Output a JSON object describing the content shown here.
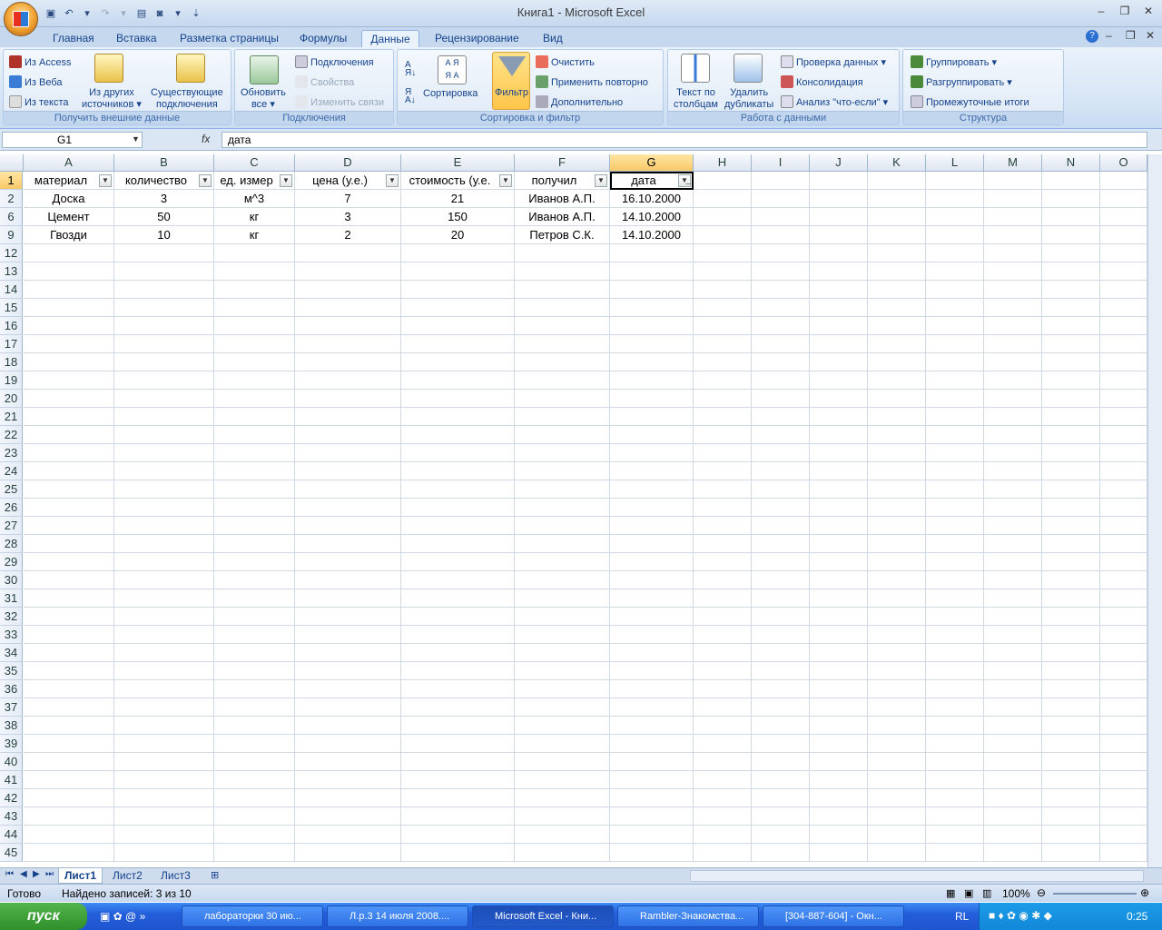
{
  "window": {
    "title": "Книга1 - Microsoft Excel"
  },
  "tabs": [
    "Главная",
    "Вставка",
    "Разметка страницы",
    "Формулы",
    "Данные",
    "Рецензирование",
    "Вид"
  ],
  "ribbon": {
    "get_external": {
      "label": "Получить внешние данные",
      "access": "Из Access",
      "web": "Из Веба",
      "text": "Из текста",
      "other1": "Из других",
      "other2": "источников",
      "existing1": "Существующие",
      "existing2": "подключения"
    },
    "connections": {
      "label": "Подключения",
      "refresh1": "Обновить",
      "refresh2": "все",
      "conn": "Подключения",
      "props": "Свойства",
      "links": "Изменить связи"
    },
    "sortfilter": {
      "label": "Сортировка и фильтр",
      "sort": "Сортировка",
      "filter": "Фильтр",
      "clear": "Очистить",
      "reapply": "Применить повторно",
      "advanced": "Дополнительно",
      "az": "А Я",
      "za": "Я А"
    },
    "datatools": {
      "label": "Работа с данными",
      "text1": "Текст по",
      "text2": "столбцам",
      "dup1": "Удалить",
      "dup2": "дубликаты",
      "validate": "Проверка данных",
      "consol": "Консолидация",
      "whatif": "Анализ \"что-если\""
    },
    "outline": {
      "label": "Структура",
      "group": "Группировать",
      "ungroup": "Разгруппировать",
      "subtotal": "Промежуточные итоги"
    }
  },
  "formula_bar": {
    "name_box": "G1",
    "fx": "fx",
    "value": "дата"
  },
  "columns": [
    "A",
    "B",
    "C",
    "D",
    "E",
    "F",
    "G",
    "H",
    "I",
    "J",
    "K",
    "L",
    "M",
    "N",
    "O"
  ],
  "header_row": [
    "материал",
    "количество",
    "ед. измер",
    "цена (у.е.)",
    "стоимость (у.е.",
    "получил",
    "дата"
  ],
  "data_rows": [
    {
      "row": "2",
      "cells": [
        "Доска",
        "3",
        "м^3",
        "7",
        "21",
        "Иванов А.П.",
        "16.10.2000"
      ]
    },
    {
      "row": "6",
      "cells": [
        "Цемент",
        "50",
        "кг",
        "3",
        "150",
        "Иванов А.П.",
        "14.10.2000"
      ]
    },
    {
      "row": "9",
      "cells": [
        "Гвозди",
        "10",
        "кг",
        "2",
        "20",
        "Петров С.К.",
        "14.10.2000"
      ]
    }
  ],
  "empty_rows": [
    "12",
    "13",
    "14",
    "15",
    "16",
    "17",
    "18",
    "19",
    "20",
    "21",
    "22",
    "23",
    "24",
    "25",
    "26",
    "27",
    "28",
    "29",
    "30",
    "31",
    "32",
    "33",
    "34",
    "35",
    "36",
    "37",
    "38",
    "39",
    "40",
    "41",
    "42",
    "43",
    "44",
    "45"
  ],
  "sheets": [
    "Лист1",
    "Лист2",
    "Лист3"
  ],
  "status": {
    "ready": "Готово",
    "found": "Найдено записей: 3 из 10",
    "zoom": "100%"
  },
  "taskbar": {
    "start": "пуск",
    "buttons": [
      "лабораторки 30 ию...",
      "Л.р.3 14 июля 2008....",
      "Microsoft Excel - Кни...",
      "Rambler-Знакомства...",
      "[304-887-604] - Окн..."
    ],
    "lang": "RL",
    "clock": "0:25"
  }
}
